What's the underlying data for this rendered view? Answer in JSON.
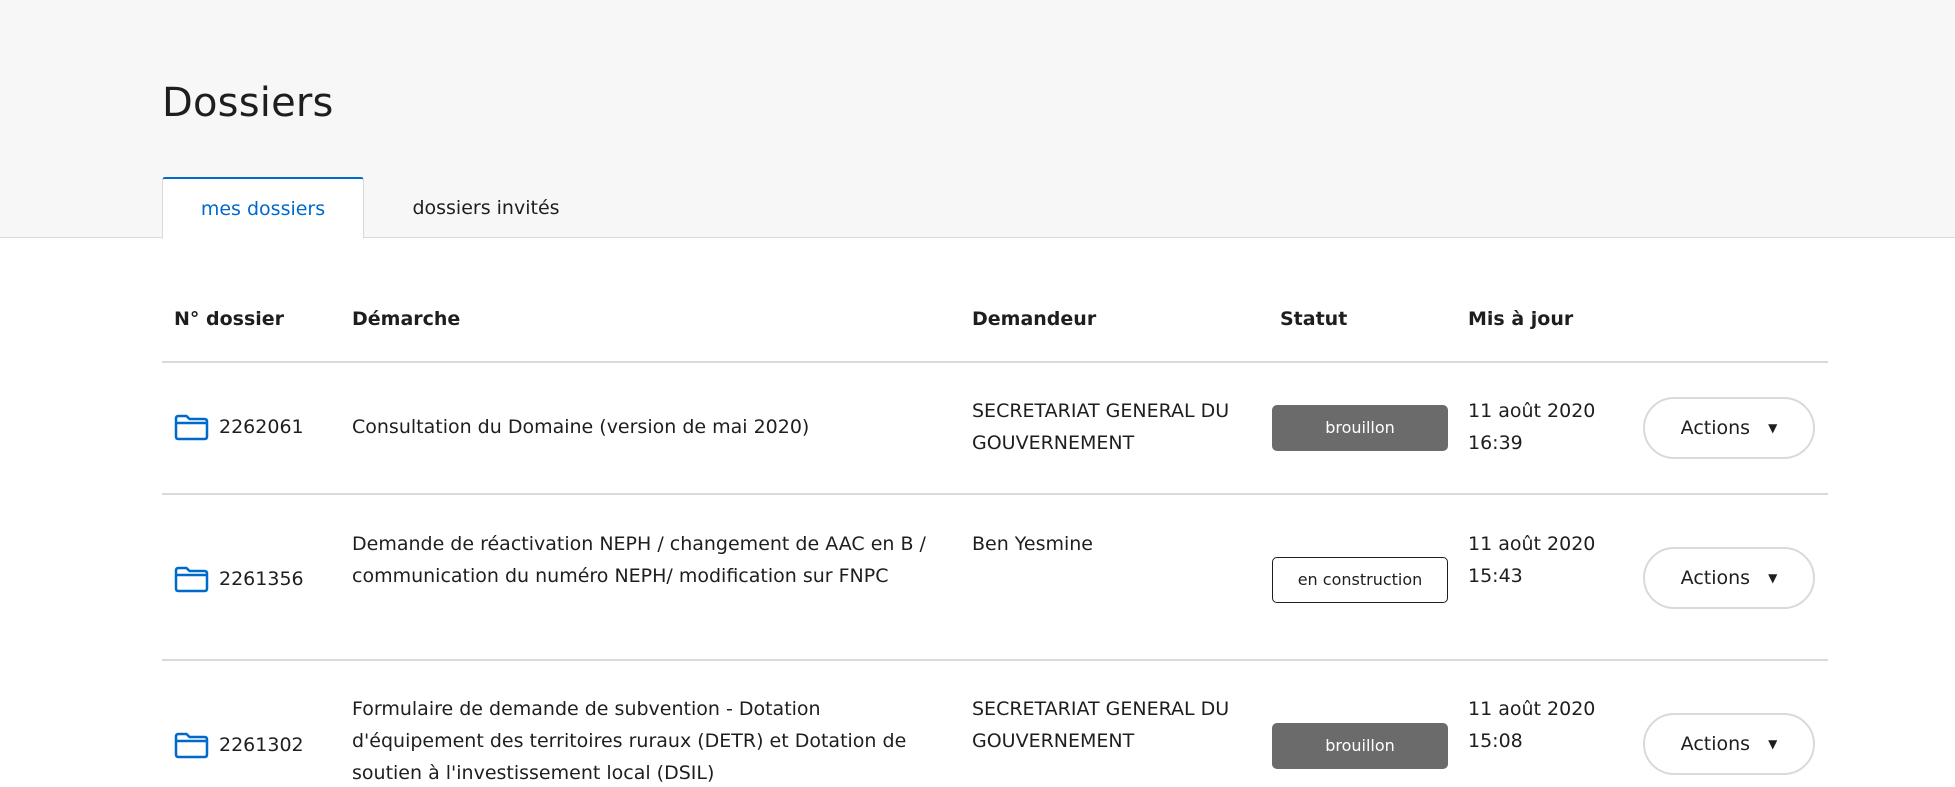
{
  "page": {
    "title": "Dossiers"
  },
  "tabs": [
    {
      "label": "mes dossiers",
      "active": true
    },
    {
      "label": "dossiers invités",
      "active": false
    }
  ],
  "table": {
    "headers": {
      "number": "N° dossier",
      "demarche": "Démarche",
      "demandeur": "Demandeur",
      "statut": "Statut",
      "updated": "Mis à jour"
    },
    "rows": [
      {
        "icon": "folder-icon",
        "number": "2262061",
        "demarche": "Consultation du Domaine (version de mai 2020)",
        "demandeur": "SECRETARIAT GENERAL DU GOUVERNEMENT",
        "statut": "brouillon",
        "date": "11 août 2020",
        "time": "16:39",
        "action_label": "Actions"
      },
      {
        "icon": "folder-icon",
        "number": "2261356",
        "demarche": "Demande de réactivation NEPH / changement de AAC en B / communication du numéro NEPH/ modification sur FNPC",
        "demandeur": "Ben Yesmine",
        "statut": "en construction",
        "date": "11 août 2020",
        "time": "15:43",
        "action_label": "Actions"
      },
      {
        "icon": "folder-icon",
        "number": "2261302",
        "demarche": "Formulaire de demande de subvention - Dotation d'équipement des territoires ruraux (DETR) et Dotation de soutien à l'investissement local (DSIL)",
        "demandeur": "SECRETARIAT GENERAL DU GOUVERNEMENT",
        "statut": "brouillon",
        "date": "11 août 2020",
        "time": "15:08",
        "action_label": "Actions"
      }
    ]
  },
  "colors": {
    "accent": "#0069cc",
    "draft_badge": "#6b6b6b",
    "header_band": "#f7f7f7",
    "border": "#d9d9d9"
  }
}
